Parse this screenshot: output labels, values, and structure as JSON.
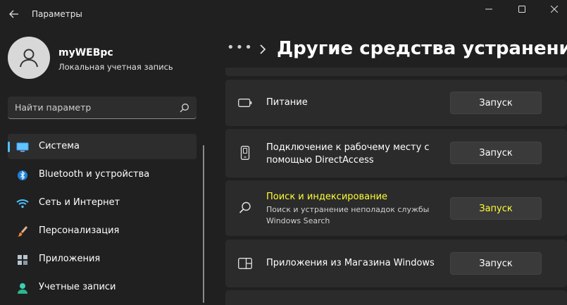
{
  "window": {
    "title": "Параметры"
  },
  "user": {
    "name": "myWEBpc",
    "account_type": "Локальная учетная запись"
  },
  "search": {
    "placeholder": "Найти параметр"
  },
  "nav": {
    "items": [
      {
        "label": "Система",
        "icon": "monitor-icon",
        "active": true
      },
      {
        "label": "Bluetooth и устройства",
        "icon": "bluetooth-icon"
      },
      {
        "label": "Сеть и Интернет",
        "icon": "wifi-icon"
      },
      {
        "label": "Персонализация",
        "icon": "brush-icon"
      },
      {
        "label": "Приложения",
        "icon": "apps-icon"
      },
      {
        "label": "Учетные записи",
        "icon": "person-icon"
      }
    ]
  },
  "header": {
    "breadcrumb_more": "•••",
    "title": "Другие средства устранения неполадок"
  },
  "troubleshooters": [
    {
      "title": "Питание",
      "description": "",
      "icon": "battery-icon",
      "button": "Запуск"
    },
    {
      "title": "Подключение к рабочему месту с помощью DirectAccess",
      "description": "",
      "icon": "phone-icon",
      "button": "Запуск"
    },
    {
      "title": "Поиск и индексирование",
      "description": "Поиск и устранение неполадок службы Windows Search",
      "icon": "search-icon",
      "button": "Запуск",
      "highlighted": true
    },
    {
      "title": "Приложения из Магазина Windows",
      "description": "",
      "icon": "window-icon",
      "button": "Запуск"
    }
  ],
  "colors": {
    "accent": "#4cc2ff",
    "background": "#202020",
    "card": "#2b2b2b",
    "highlight": "#ffff33"
  }
}
